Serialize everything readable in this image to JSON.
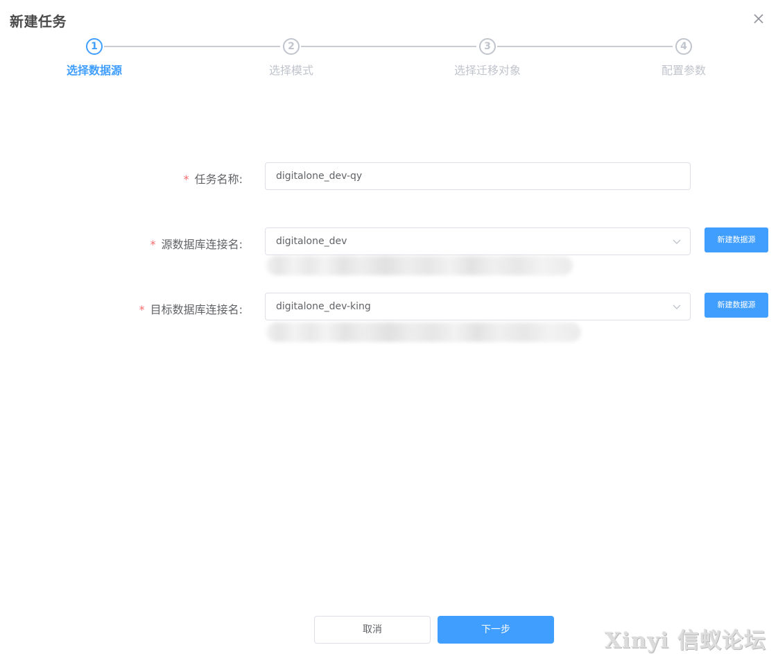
{
  "dialog": {
    "title": "新建任务",
    "close_icon": "close-icon"
  },
  "steps": [
    {
      "number": "1",
      "label": "选择数据源",
      "status": "active"
    },
    {
      "number": "2",
      "label": "选择模式",
      "status": "wait"
    },
    {
      "number": "3",
      "label": "选择迁移对象",
      "status": "wait"
    },
    {
      "number": "4",
      "label": "配置参数",
      "status": "wait"
    }
  ],
  "form": {
    "required_mark": "*",
    "task_name": {
      "label": "任务名称:",
      "value": "digitalone_dev-qy"
    },
    "source_db": {
      "label": "源数据库连接名:",
      "value": "digitalone_dev",
      "icon": "chevron-down-icon"
    },
    "target_db": {
      "label": "目标数据库连接名:",
      "value": "digitalone_dev-king",
      "icon": "chevron-down-icon"
    },
    "new_datasource_label": "新建数据源"
  },
  "footer": {
    "cancel_label": "取消",
    "next_label": "下一步"
  },
  "watermark": "Xinyi 信蚁论坛",
  "colors": {
    "primary": "#409eff",
    "required": "#f56c6c",
    "inactive": "#c0c4cc",
    "label": "#606266"
  }
}
